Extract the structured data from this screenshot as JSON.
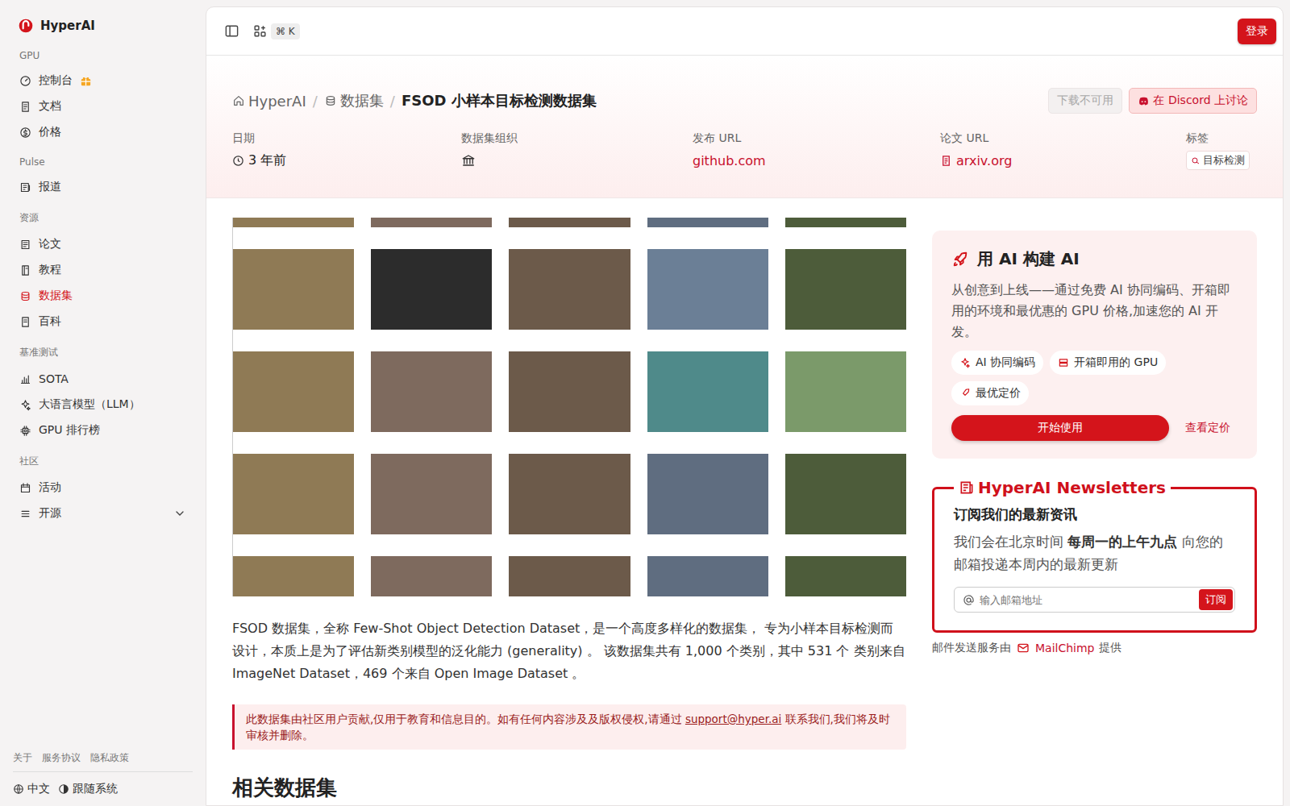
{
  "sidebar": {
    "logo": "HyperAI",
    "sections": [
      {
        "label": "GPU",
        "items": [
          {
            "label": "控制台",
            "kind": "gift",
            "selected": false
          },
          {
            "label": "文档",
            "kind": "plain",
            "selected": false
          },
          {
            "label": "价格",
            "kind": "plain",
            "selected": false
          }
        ]
      },
      {
        "label": "Pulse",
        "items": [
          {
            "label": "报道",
            "kind": "plain",
            "selected": false
          }
        ]
      },
      {
        "label": "资源",
        "items": [
          {
            "label": "论文",
            "kind": "plain",
            "selected": false
          },
          {
            "label": "教程",
            "kind": "plain",
            "selected": false
          },
          {
            "label": "数据集",
            "kind": "plain",
            "selected": true
          },
          {
            "label": "百科",
            "kind": "plain",
            "selected": false
          }
        ]
      },
      {
        "label": "基准测试",
        "items": [
          {
            "label": "SOTA",
            "kind": "plain",
            "selected": false
          },
          {
            "label": "大语言模型（LLM）",
            "kind": "plain",
            "selected": false
          },
          {
            "label": "GPU 排行榜",
            "kind": "plain",
            "selected": false
          }
        ]
      },
      {
        "label": "社区",
        "items": [
          {
            "label": "活动",
            "kind": "plain",
            "selected": false
          },
          {
            "label": "开源",
            "kind": "expandable",
            "selected": false,
            "expanded": false
          }
        ]
      }
    ],
    "footer_links": [
      "关于",
      "服务协议",
      "隐私政策"
    ],
    "language": "中文",
    "theme": "跟随系统"
  },
  "topbar": {
    "shortcut": "⌘ K",
    "login": "登录"
  },
  "header": {
    "breadcrumb": [
      {
        "label": "HyperAI",
        "current": false
      },
      {
        "label": "数据集",
        "current": false
      },
      {
        "label": "FSOD 小样本目标检测数据集",
        "current": true
      }
    ],
    "separator": "/",
    "actions": [
      {
        "label": "下载不可用",
        "disabled": true
      },
      {
        "label": "在 Discord 上讨论",
        "disabled": false
      }
    ],
    "meta": [
      {
        "label": "日期",
        "kind": "time",
        "value": "3 年前"
      },
      {
        "label": "数据集组织",
        "kind": "org"
      },
      {
        "label": "发布 URL",
        "kind": "link",
        "value": "github.com"
      },
      {
        "label": "论文 URL",
        "kind": "paper",
        "value": "arxiv.org"
      },
      {
        "label": "标签",
        "kind": "tag",
        "value": "目标检测"
      }
    ]
  },
  "content": {
    "description": "FSOD 数据集，全称 Few-Shot Object Detection Dataset，是一个高度多样化的数据集， 专为小样本目标检测而设计，本质上是为了评估新类别模型的泛化能力 (generality) 。 该数据集共有 1,000 个类别，其中 531 个 类别来自 ImageNet Dataset，469 个来自 Open Image Dataset 。",
    "notice": {
      "before": "此数据集由社区用户贡献,仅用于教育和信息目的。如有任何内容涉及及版权侵权,请通过 ",
      "email": "support@hyper.ai",
      "after": " 联系我们,我们将及时审核并删除。"
    },
    "related_heading": "相关数据集"
  },
  "promo": {
    "title": "用 AI 构建 AI",
    "description": "从创意到上线——通过免费 AI 协同编码、开箱即用的环境和最优惠的 GPU 价格,加速您的 AI 开发。",
    "features": [
      "AI 协同编码",
      "开箱即用的 GPU",
      "最优定价"
    ],
    "primary": "开始使用",
    "secondary": "查看定价"
  },
  "newsletter": {
    "legend": "HyperAI Newsletters",
    "title": "订阅我们的最新资讯",
    "text": [
      {
        "text": "我们会在北京时间 ",
        "bold": false
      },
      {
        "text": "每周一的上午九点",
        "bold": true
      },
      {
        "text": " 向您的邮箱投递本周内的最新更新",
        "bold": false
      }
    ],
    "placeholder": "输入邮箱地址",
    "button": "订阅",
    "provider": {
      "before": "邮件发送服务由",
      "name": "MailChimp",
      "after": "提供"
    }
  }
}
